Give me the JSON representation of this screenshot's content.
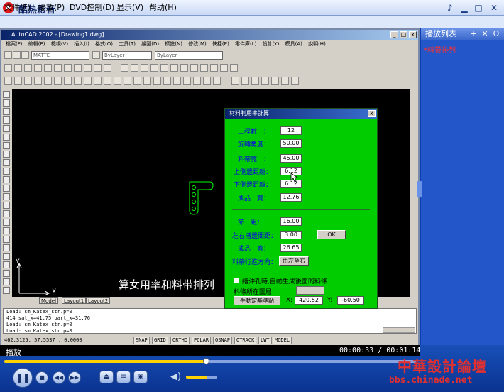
{
  "player": {
    "title": "酷热影音",
    "menus": [
      "文件(F)",
      "播放(P)",
      "DVD控制(D)",
      "显示(V)",
      "帮助(H)"
    ],
    "status": "播放",
    "time_elapsed": "00:00:33",
    "time_separator": "/",
    "time_total": "00:01:14",
    "progress_fraction": 0.49,
    "volume_fraction": 0.68
  },
  "playlist": {
    "header": "播放列表",
    "items": [
      "*料带排列"
    ]
  },
  "cad": {
    "title": "AutoCAD 2002 - [Drawing1.dwg]",
    "menus": "檔案(F) 編輯(E) 檢視(V) 插入(I) 格式(O) 工具(T) 繪圖(D) 標註(N) 修改(M) 快捷(E) 零件庫(L) 設計(Y) 模具(A) 說明(H)",
    "layer_combo": "MATTE",
    "layer2_combo": "ByLayer",
    "linetype_combo": "ByLayer",
    "caption_overlay": "算女用率和料带排列",
    "model_tabs": [
      "Model",
      "Layout1",
      "Layout2"
    ],
    "command_lines": [
      "Load: sm_Katex_str.p=0",
      "414 sat_x=41.75 part_x=31.76",
      "Load: sm_Katex_str.p=0",
      "Load: sm_Katex_str.p=0"
    ],
    "coords": "462.3125, 57.5537 , 0.0000",
    "status_buttons": [
      "SNAP",
      "GRID",
      "ORTHO",
      "POLAR",
      "OSNAP",
      "OTRACK",
      "LWT",
      "MODEL"
    ],
    "ucs_y": "Y",
    "ucs_x": "X"
  },
  "dialog": {
    "title": "材料利用率計算",
    "fields": [
      {
        "label": "工程數　：",
        "value": "12"
      },
      {
        "label": "旋轉角度：",
        "value": "50.00"
      },
      {
        "label": "料帶寬　：",
        "value": "45.00"
      },
      {
        "label": "上側邊距離：",
        "value": "6.12"
      },
      {
        "label": "下側邊距離：",
        "value": "6.12"
      },
      {
        "label": "成品　寬：",
        "value": "12.76"
      }
    ],
    "pitch_label": "節　距：",
    "pitch_value": "16.00",
    "lr_label": "左右搭邊間距：",
    "lr_value": "3.00",
    "ok_label": "OK",
    "product_label": "成品　寬：",
    "product_value": "26.65",
    "direction_label": "料帶行進方向：",
    "direction_button": "由左至右",
    "checkbox_label": "繪沖孔時,自動生成後面的料條",
    "layer_label": "料條所在圖層",
    "base_button": "手動定基準點",
    "x_label": "X:",
    "x_value": "420.52",
    "y_label": "Y:",
    "y_value": "-60.50"
  },
  "watermark": {
    "name": "中華設計論壇",
    "site": "bbs.chinade.net"
  },
  "colors": {
    "dialog_bg": "#00cc00",
    "dialog_label": "#0000ee",
    "playlist_item": "#ff3030",
    "seek_fill": "#ffd200"
  }
}
